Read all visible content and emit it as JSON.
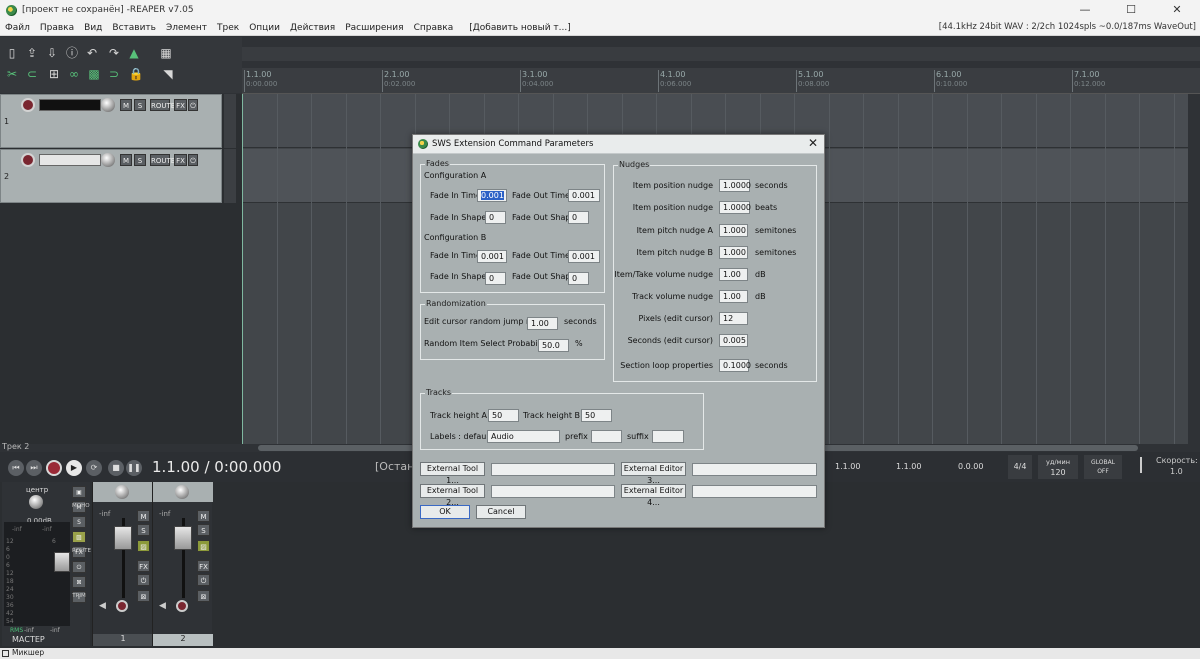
{
  "window": {
    "title": "[проект не сохранён] -REAPER v7.05",
    "controls": {
      "minimize": "—",
      "maximize": "☐",
      "close": "✕"
    }
  },
  "menu": {
    "items": [
      "Файл",
      "Правка",
      "Вид",
      "Вставить",
      "Элемент",
      "Трек",
      "Опции",
      "Действия",
      "Расширения",
      "Справка",
      "[Добавить новый т...]"
    ],
    "status": "[44.1kHz 24bit WAV : 2/2ch 1024spls ~0.0/187ms WaveOut]"
  },
  "ruler": {
    "marks": [
      {
        "bar": "1.1.00",
        "time": "0:00.000"
      },
      {
        "bar": "2.1.00",
        "time": "0:02.000"
      },
      {
        "bar": "3.1.00",
        "time": "0:04.000"
      },
      {
        "bar": "4.1.00",
        "time": "0:06.000"
      },
      {
        "bar": "5.1.00",
        "time": "0:08.000"
      },
      {
        "bar": "6.1.00",
        "time": "0:10.000"
      },
      {
        "bar": "7.1.00",
        "time": "0:12.000"
      }
    ]
  },
  "tracks": [
    {
      "number": "1",
      "buttons": [
        "M",
        "S",
        "ROUTE",
        "FX"
      ]
    },
    {
      "number": "2",
      "buttons": [
        "M",
        "S",
        "ROUTE",
        "FX"
      ]
    }
  ],
  "track_panel_footer": "Трек 2",
  "transport": {
    "position": "1.1.00 / 0:00.000",
    "status": "[Остан",
    "sel_start": "1.1.00",
    "sel_end": "1.1.00",
    "sel_len": "0.0.00",
    "time_sig": "4/4",
    "bpm_label": "уд/мин",
    "bpm": "120",
    "global_label": "GLOBAL",
    "global_state": "OFF",
    "rate_label": "Скорость:",
    "rate": "1.0"
  },
  "mixer": {
    "master": {
      "center_label": "центр",
      "db": "0.00dB",
      "inf_left": "-inf",
      "inf_right": "-inf",
      "rms_label": "RMS",
      "rms_left": "-inf",
      "rms_right": "-inf",
      "label": "МАСТЕР",
      "mono_label": "МОНО",
      "route_label": "ROUTE",
      "trim_label": "TRIM",
      "scale": [
        "12",
        "6",
        "0",
        "6",
        "12",
        "18",
        "24",
        "30",
        "36",
        "42",
        "54",
        "6"
      ]
    },
    "strips": [
      {
        "number": "1",
        "inf": "-inf"
      },
      {
        "number": "2",
        "inf": "-inf"
      }
    ],
    "tab_label": "Микшер"
  },
  "dialog": {
    "title": "SWS Extension Command Parameters",
    "fades": {
      "group": "Fades",
      "config_a": "Configuration A",
      "config_b": "Configuration B",
      "fade_in_time_label": "Fade In Time",
      "fade_out_time_label": "Fade Out Time",
      "fade_in_shape_label": "Fade In Shape",
      "fade_out_shape_label": "Fade Out Shape",
      "a_fade_in_time": "0.001",
      "a_fade_out_time": "0.001",
      "a_fade_in_shape": "0",
      "a_fade_out_shape": "0",
      "b_fade_in_time": "0.001",
      "b_fade_out_time": "0.001",
      "b_fade_in_shape": "0",
      "b_fade_out_shape": "0"
    },
    "randomization": {
      "group": "Randomization",
      "jump_label": "Edit cursor random jump mean",
      "jump_value": "1.00",
      "jump_unit": "seconds",
      "prob_label": "Random Item Select Probability",
      "prob_value": "50.0",
      "prob_unit": "%"
    },
    "nudges": {
      "group": "Nudges",
      "rows": [
        {
          "label": "Item position nudge",
          "value": "1.0000",
          "unit": "seconds"
        },
        {
          "label": "Item position nudge",
          "value": "1.0000",
          "unit": "beats"
        },
        {
          "label": "Item pitch nudge A",
          "value": "1.000",
          "unit": "semitones"
        },
        {
          "label": "Item pitch nudge B",
          "value": "1.000",
          "unit": "semitones"
        },
        {
          "label": "Item/Take volume nudge",
          "value": "1.00",
          "unit": "dB"
        },
        {
          "label": "Track volume nudge",
          "value": "1.00",
          "unit": "dB"
        },
        {
          "label": "Pixels (edit cursor)",
          "value": "12",
          "unit": ""
        },
        {
          "label": "Seconds (edit cursor)",
          "value": "0.005",
          "unit": ""
        },
        {
          "label": "Section loop properties",
          "value": "0.1000",
          "unit": "seconds"
        }
      ]
    },
    "tracks": {
      "group": "Tracks",
      "height_a_label": "Track height A",
      "height_a": "50",
      "height_b_label": "Track height B",
      "height_b": "50",
      "labels_label": "Labels : default",
      "labels_default": "Audio",
      "prefix_label": "prefix",
      "prefix": "",
      "suffix_label": "suffix",
      "suffix": ""
    },
    "external": {
      "tool1": "External Tool 1...",
      "tool2": "External Tool 2...",
      "editor3": "External Editor 3...",
      "editor4": "External Editor 4...",
      "tool1_path": "",
      "tool2_path": "",
      "editor3_path": "",
      "editor4_path": ""
    },
    "ok": "OK",
    "cancel": "Cancel"
  },
  "colors": {
    "dialog_bg": "#a9b0b1",
    "record": "#9a2a37",
    "accent_green": "#58c27a"
  }
}
